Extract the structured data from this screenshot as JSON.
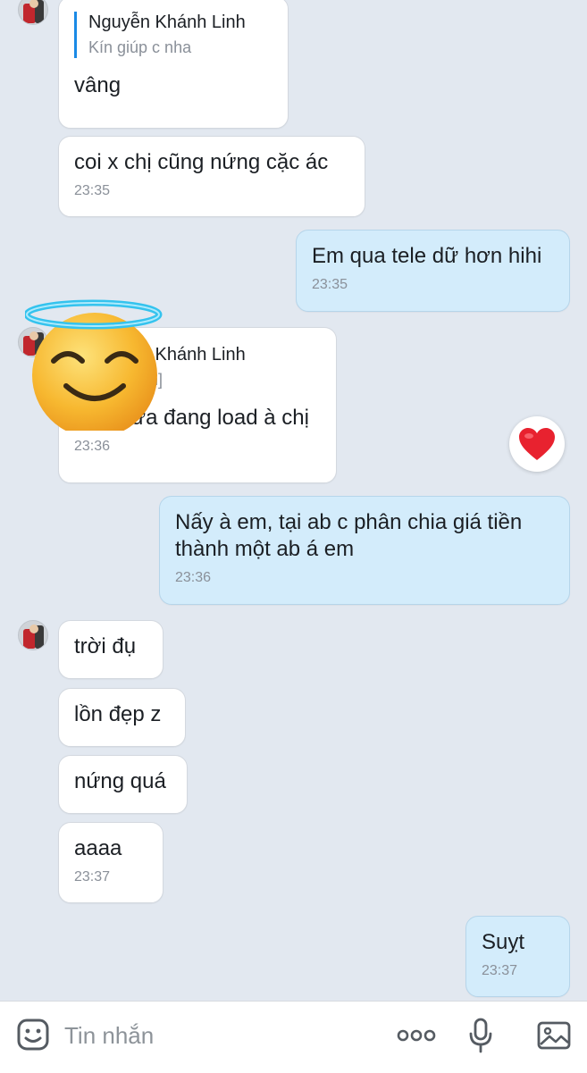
{
  "messages": [
    {
      "sender": "other",
      "quote": {
        "name": "Nguyễn Khánh Linh",
        "text": "Kín giúp c nha"
      },
      "text": "vâng"
    },
    {
      "sender": "other",
      "text": "coi x chị cũng nứng cặc ác",
      "time": "23:35"
    },
    {
      "sender": "me",
      "text": "Em qua tele dữ hơn hihi",
      "time": "23:35"
    },
    {
      "sender": "other",
      "quote": {
        "name": "Nguyễn Khánh Linh",
        "text": "[Hình ảnh]"
      },
      "text": "Còn nữa đang load à chị",
      "time": "23:36",
      "reaction": "heart-icon"
    },
    {
      "sender": "me",
      "text": "Nấy à em, tại ab c phân chia giá tiền\nthành một ab á em",
      "time": "23:36"
    },
    {
      "sender": "other",
      "text": "trời đụ"
    },
    {
      "sender": "other",
      "text": "lồn đẹp z"
    },
    {
      "sender": "other",
      "text": "nứng quá"
    },
    {
      "sender": "other",
      "text": "aaaa",
      "time": "23:37"
    },
    {
      "sender": "me",
      "text": "Suỵt",
      "time": "23:37"
    }
  ],
  "composer": {
    "placeholder": "Tin nhắn",
    "icons": [
      "sticker-icon",
      "more-icon",
      "microphone-icon",
      "image-icon"
    ]
  },
  "colors": {
    "background": "#e2e8f0",
    "incoming_bubble": "#ffffff",
    "outgoing_bubble": "#d3ecfb",
    "quote_bar": "#1a8ae6",
    "reaction": "#e8222f"
  }
}
